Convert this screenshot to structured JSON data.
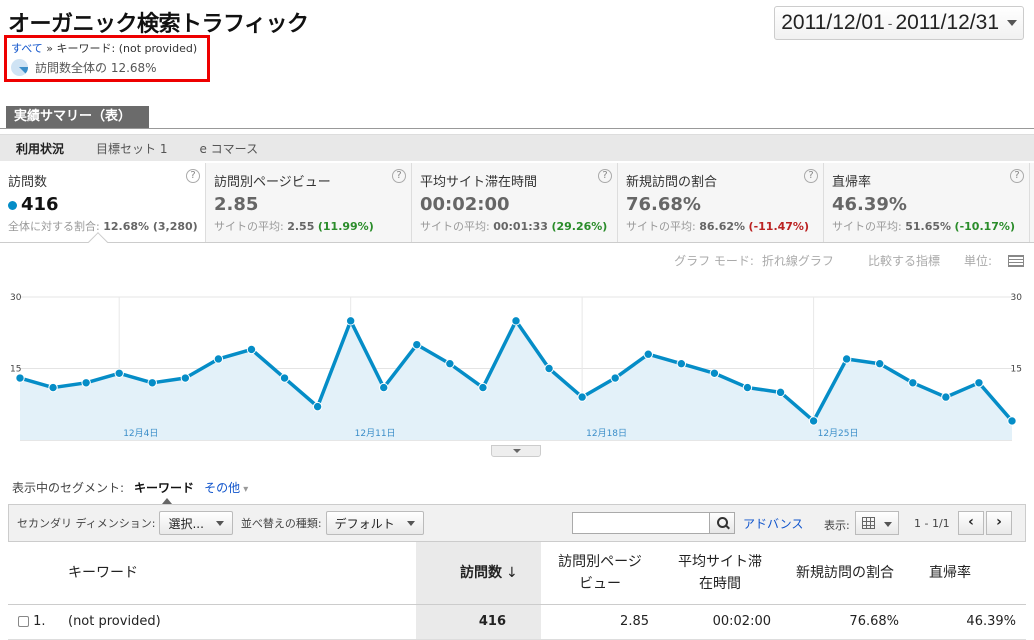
{
  "header": {
    "title": "オーガニック検索トラフィック",
    "date_start": "2011/12/01",
    "date_sep": "-",
    "date_end": "2011/12/31"
  },
  "breadcrumb": {
    "all": "すべて",
    "sep": "»",
    "current": "キーワード: (not provided)"
  },
  "visits_share": {
    "text": "訪問数全体の 12.68%",
    "percent": 12.68
  },
  "report_tab": "実績サマリー（表）",
  "subtabs": [
    "利用状況",
    "目標セット 1",
    "e コマース"
  ],
  "metrics": [
    {
      "name": "訪問数",
      "value": "416",
      "sub_label": "全体に対する割合:",
      "sub_value": "12.68% (3,280)",
      "delta": "",
      "help": "?"
    },
    {
      "name": "訪問別ページビュー",
      "value": "2.85",
      "sub_label": "サイトの平均:",
      "sub_value": "2.55",
      "delta": "(11.99%)",
      "delta_class": "pos",
      "help": "?"
    },
    {
      "name": "平均サイト滞在時間",
      "value": "00:02:00",
      "sub_label": "サイトの平均:",
      "sub_value": "00:01:33",
      "delta": "(29.26%)",
      "delta_class": "pos",
      "help": "?"
    },
    {
      "name": "新規訪問の割合",
      "value": "76.68%",
      "sub_label": "サイトの平均:",
      "sub_value": "86.62%",
      "delta": "(-11.47%)",
      "delta_class": "neg",
      "help": "?"
    },
    {
      "name": "直帰率",
      "value": "46.39%",
      "sub_label": "サイトの平均:",
      "sub_value": "51.65%",
      "delta": "(-10.17%)",
      "delta_class": "pos",
      "help": "?"
    }
  ],
  "graph_controls": {
    "mode": "グラフ モード:",
    "mode_value": "折れ線グラフ",
    "compare": "比較する指標",
    "unit": "単位:"
  },
  "chart_data": {
    "type": "area",
    "x": [
      "12/1",
      "12/2",
      "12/3",
      "12/4",
      "12/5",
      "12/6",
      "12/7",
      "12/8",
      "12/9",
      "12/10",
      "12/11",
      "12/12",
      "12/13",
      "12/14",
      "12/15",
      "12/16",
      "12/17",
      "12/18",
      "12/19",
      "12/20",
      "12/21",
      "12/22",
      "12/23",
      "12/24",
      "12/25",
      "12/26",
      "12/27",
      "12/28",
      "12/29",
      "12/30",
      "12/31"
    ],
    "series": [
      {
        "values": [
          13,
          11,
          12,
          14,
          12,
          13,
          17,
          19,
          13,
          7,
          25,
          11,
          20,
          16,
          11,
          25,
          15,
          9,
          13,
          18,
          16,
          14,
          11,
          10,
          4,
          17,
          16,
          12,
          9,
          12,
          4
        ]
      }
    ],
    "ylim": [
      0,
      30
    ],
    "yticks_left": [
      "30",
      "15"
    ],
    "yticks_right": [
      "30",
      "15"
    ],
    "xtick_labels": [
      "12月4日",
      "12月11日",
      "12月18日",
      "12月25日"
    ],
    "color": "#058dc7",
    "fill": "#e3f1f9"
  },
  "segment": {
    "label": "表示中のセグメント:",
    "active": "キーワード",
    "other": "その他"
  },
  "toolbar": {
    "secondary_label": "セカンダリ ディメンション:",
    "secondary_value": "選択...",
    "sort_label": "並べ替えの種類:",
    "sort_value": "デフォルト",
    "search_placeholder": "",
    "advanced": "アドバンス",
    "view_label": "表示:",
    "pager": "1 - 1/1",
    "prev": "‹",
    "next": "›"
  },
  "table": {
    "headers": [
      "キーワード",
      "訪問数",
      "↓",
      "訪問別ページ\nビュー",
      "平均サイト滞\n在時間",
      "新規訪問の割合",
      "直帰率"
    ],
    "rows": [
      {
        "index": "1.",
        "keyword": "(not provided)",
        "visits": "416",
        "pv": "2.85",
        "time": "00:02:00",
        "new": "76.68%",
        "bounce": "46.39%"
      }
    ]
  }
}
